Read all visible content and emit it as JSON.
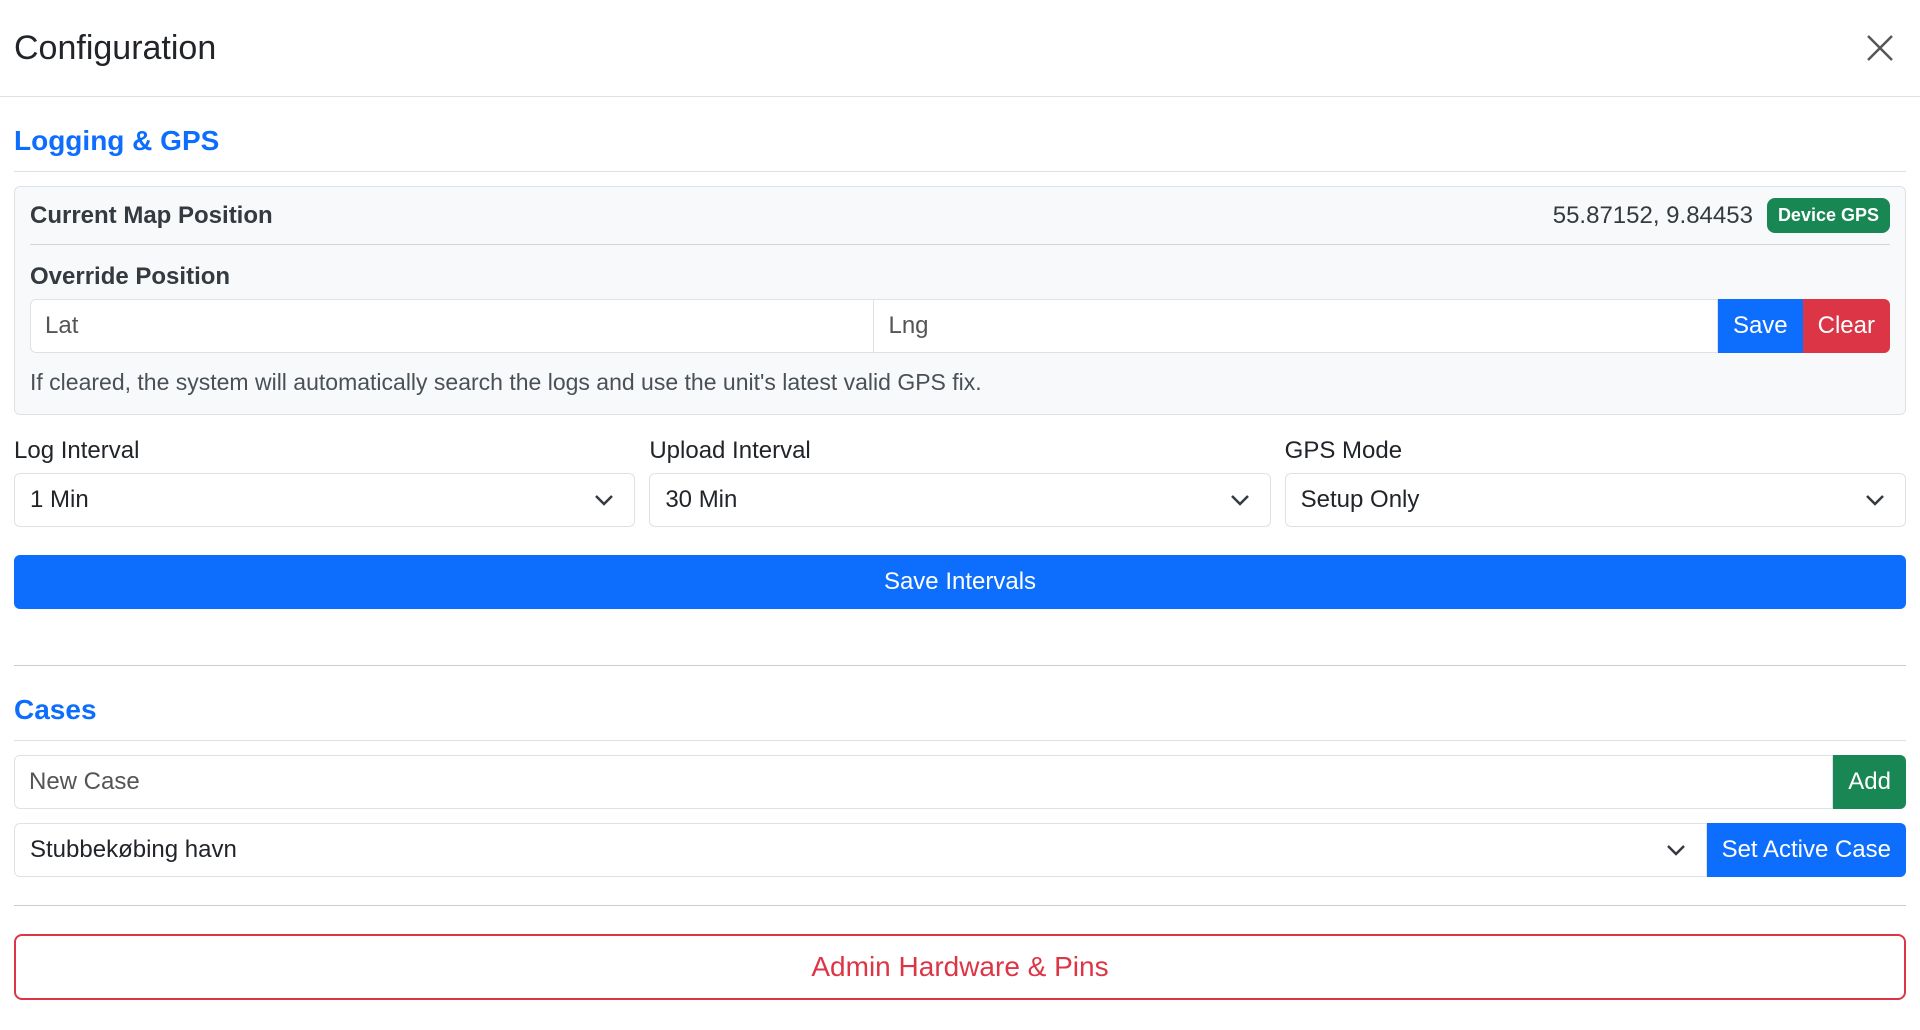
{
  "header": {
    "title": "Configuration"
  },
  "logging": {
    "section_title": "Logging & GPS",
    "current_position_label": "Current Map Position",
    "current_position_value": "55.87152, 9.84453",
    "position_badge": "Device GPS",
    "override_label": "Override Position",
    "lat_placeholder": "Lat",
    "lng_placeholder": "Lng",
    "save_label": "Save",
    "clear_label": "Clear",
    "help_text": "If cleared, the system will automatically search the logs and use the unit's latest valid GPS fix.",
    "log_interval_label": "Log Interval",
    "log_interval_value": "1 Min",
    "upload_interval_label": "Upload Interval",
    "upload_interval_value": "30 Min",
    "gps_mode_label": "GPS Mode",
    "gps_mode_value": "Setup Only",
    "save_intervals_label": "Save Intervals"
  },
  "cases": {
    "section_title": "Cases",
    "new_case_placeholder": "New Case",
    "add_label": "Add",
    "selected_case": "Stubbekøbing havn",
    "set_active_label": "Set Active Case"
  },
  "admin": {
    "button_label": "Admin Hardware & Pins"
  },
  "colors": {
    "primary": "#0d6efd",
    "danger": "#dc3545",
    "success": "#198754"
  }
}
